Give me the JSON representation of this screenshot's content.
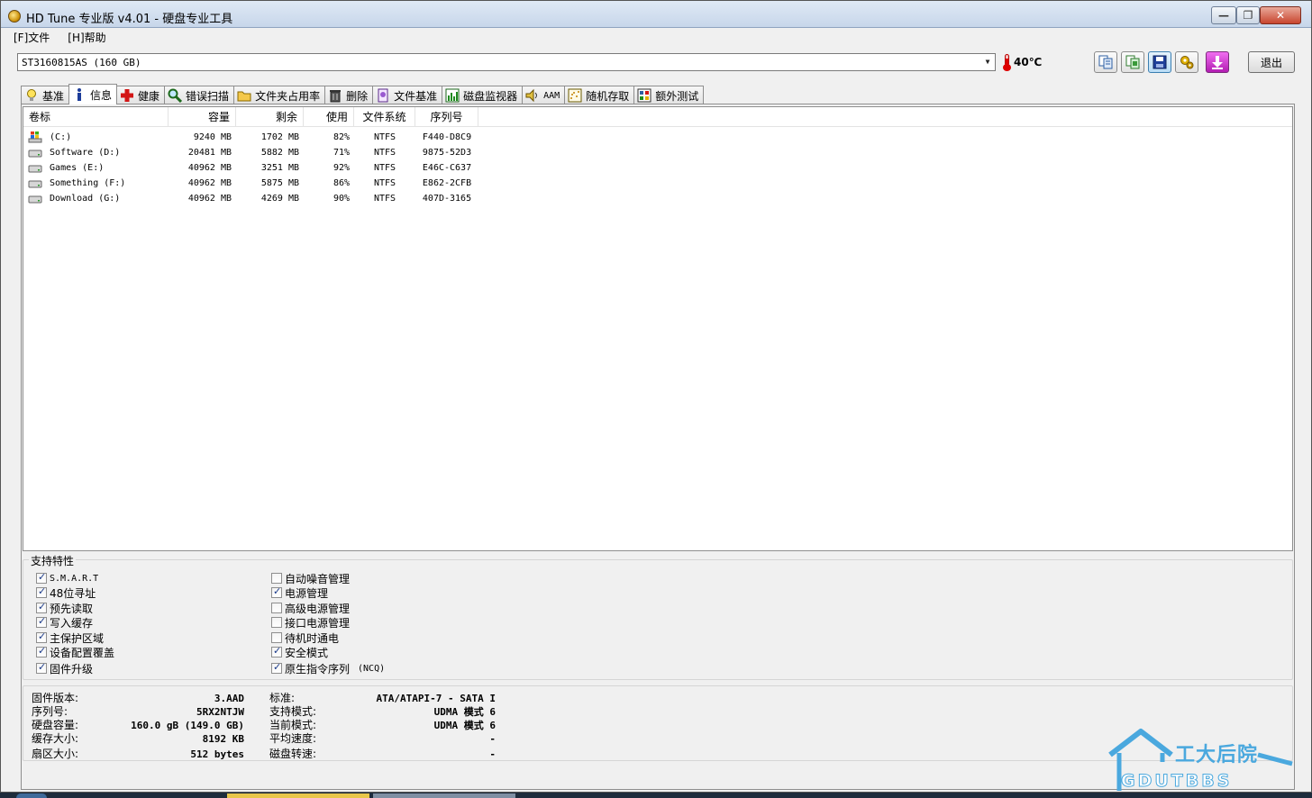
{
  "window": {
    "title": "HD Tune 专业版 v4.01 - 硬盘专业工具",
    "min_label": "—",
    "max_label": "❐",
    "close_label": "✕"
  },
  "menu": [
    "[F]文件",
    "[H]帮助"
  ],
  "toolbar": {
    "drive": "ST3160815AS (160 GB)",
    "temperature": "40℃",
    "exit_label": "退出",
    "icons": [
      "copy-text-icon",
      "copy-screenshot-icon",
      "save-icon",
      "options-icon",
      "download-icon"
    ]
  },
  "tabs": [
    {
      "label": "基准",
      "icon": "lightbulb-icon"
    },
    {
      "label": "信息",
      "icon": "info-icon",
      "active": true
    },
    {
      "label": "健康",
      "icon": "red-cross-icon"
    },
    {
      "label": "错误扫描",
      "icon": "magnifier-icon"
    },
    {
      "label": "文件夹占用率",
      "icon": "folder-icon"
    },
    {
      "label": "删除",
      "icon": "trash-icon"
    },
    {
      "label": "文件基准",
      "icon": "file-benchmark-icon"
    },
    {
      "label": "磁盘监视器",
      "icon": "disk-monitor-icon"
    },
    {
      "label": "AAM",
      "icon": "speaker-icon"
    },
    {
      "label": "随机存取",
      "icon": "random-access-icon"
    },
    {
      "label": "额外测试",
      "icon": "extra-tests-icon"
    }
  ],
  "partitions": {
    "headers": [
      "卷标",
      "容量",
      "剩余",
      "使用",
      "文件系统",
      "序列号"
    ],
    "rows": [
      {
        "label": "(C:)",
        "capacity": "9240 MB",
        "free": "1702 MB",
        "used": "82%",
        "fs": "NTFS",
        "serial": "F440-D8C9",
        "icon": "windows-drive-icon"
      },
      {
        "label": "Software (D:)",
        "capacity": "20481 MB",
        "free": "5882 MB",
        "used": "71%",
        "fs": "NTFS",
        "serial": "9875-52D3",
        "icon": "hard-drive-icon"
      },
      {
        "label": "Games (E:)",
        "capacity": "40962 MB",
        "free": "3251 MB",
        "used": "92%",
        "fs": "NTFS",
        "serial": "E46C-C637",
        "icon": "hard-drive-icon"
      },
      {
        "label": "Something (F:)",
        "capacity": "40962 MB",
        "free": "5875 MB",
        "used": "86%",
        "fs": "NTFS",
        "serial": "E862-2CFB",
        "icon": "hard-drive-icon"
      },
      {
        "label": "Download (G:)",
        "capacity": "40962 MB",
        "free": "4269 MB",
        "used": "90%",
        "fs": "NTFS",
        "serial": "407D-3165",
        "icon": "hard-drive-icon"
      }
    ]
  },
  "features": {
    "title": "支持特性",
    "left": [
      {
        "label": "S.M.A.R.T",
        "checked": true
      },
      {
        "label": "48位寻址",
        "checked": true
      },
      {
        "label": "预先读取",
        "checked": true
      },
      {
        "label": "写入缓存",
        "checked": true
      },
      {
        "label": "主保护区域",
        "checked": true
      },
      {
        "label": "设备配置覆盖",
        "checked": true
      },
      {
        "label": "固件升级",
        "checked": true
      }
    ],
    "right": [
      {
        "label": "自动噪音管理",
        "checked": false
      },
      {
        "label": "电源管理",
        "checked": true
      },
      {
        "label": "高级电源管理",
        "checked": false
      },
      {
        "label": "接口电源管理",
        "checked": false
      },
      {
        "label": "待机时通电",
        "checked": false
      },
      {
        "label": "安全模式",
        "checked": true
      },
      {
        "label": "原生指令序列",
        "suffix": "(NCQ)",
        "checked": true
      }
    ]
  },
  "details": {
    "left": [
      {
        "label": "固件版本:",
        "value": "3.AAD"
      },
      {
        "label": "序列号:",
        "value": "5RX2NTJW"
      },
      {
        "label": "硬盘容量:",
        "value": "160.0 gB (149.0 GB)"
      },
      {
        "label": "缓存大小:",
        "value": "8192 KB"
      },
      {
        "label": "扇区大小:",
        "value": "512 bytes"
      }
    ],
    "right": [
      {
        "label": "标准:",
        "value": "ATA/ATAPI-7 - SATA I"
      },
      {
        "label": "支持模式:",
        "value": "UDMA 模式 6"
      },
      {
        "label": "当前模式:",
        "value": "UDMA 模式 6"
      },
      {
        "label": "平均速度:",
        "value": "-"
      },
      {
        "label": "磁盘转速:",
        "value": "-"
      }
    ]
  },
  "watermark": {
    "cn": "工大后院",
    "en": "GDUTBBS"
  }
}
